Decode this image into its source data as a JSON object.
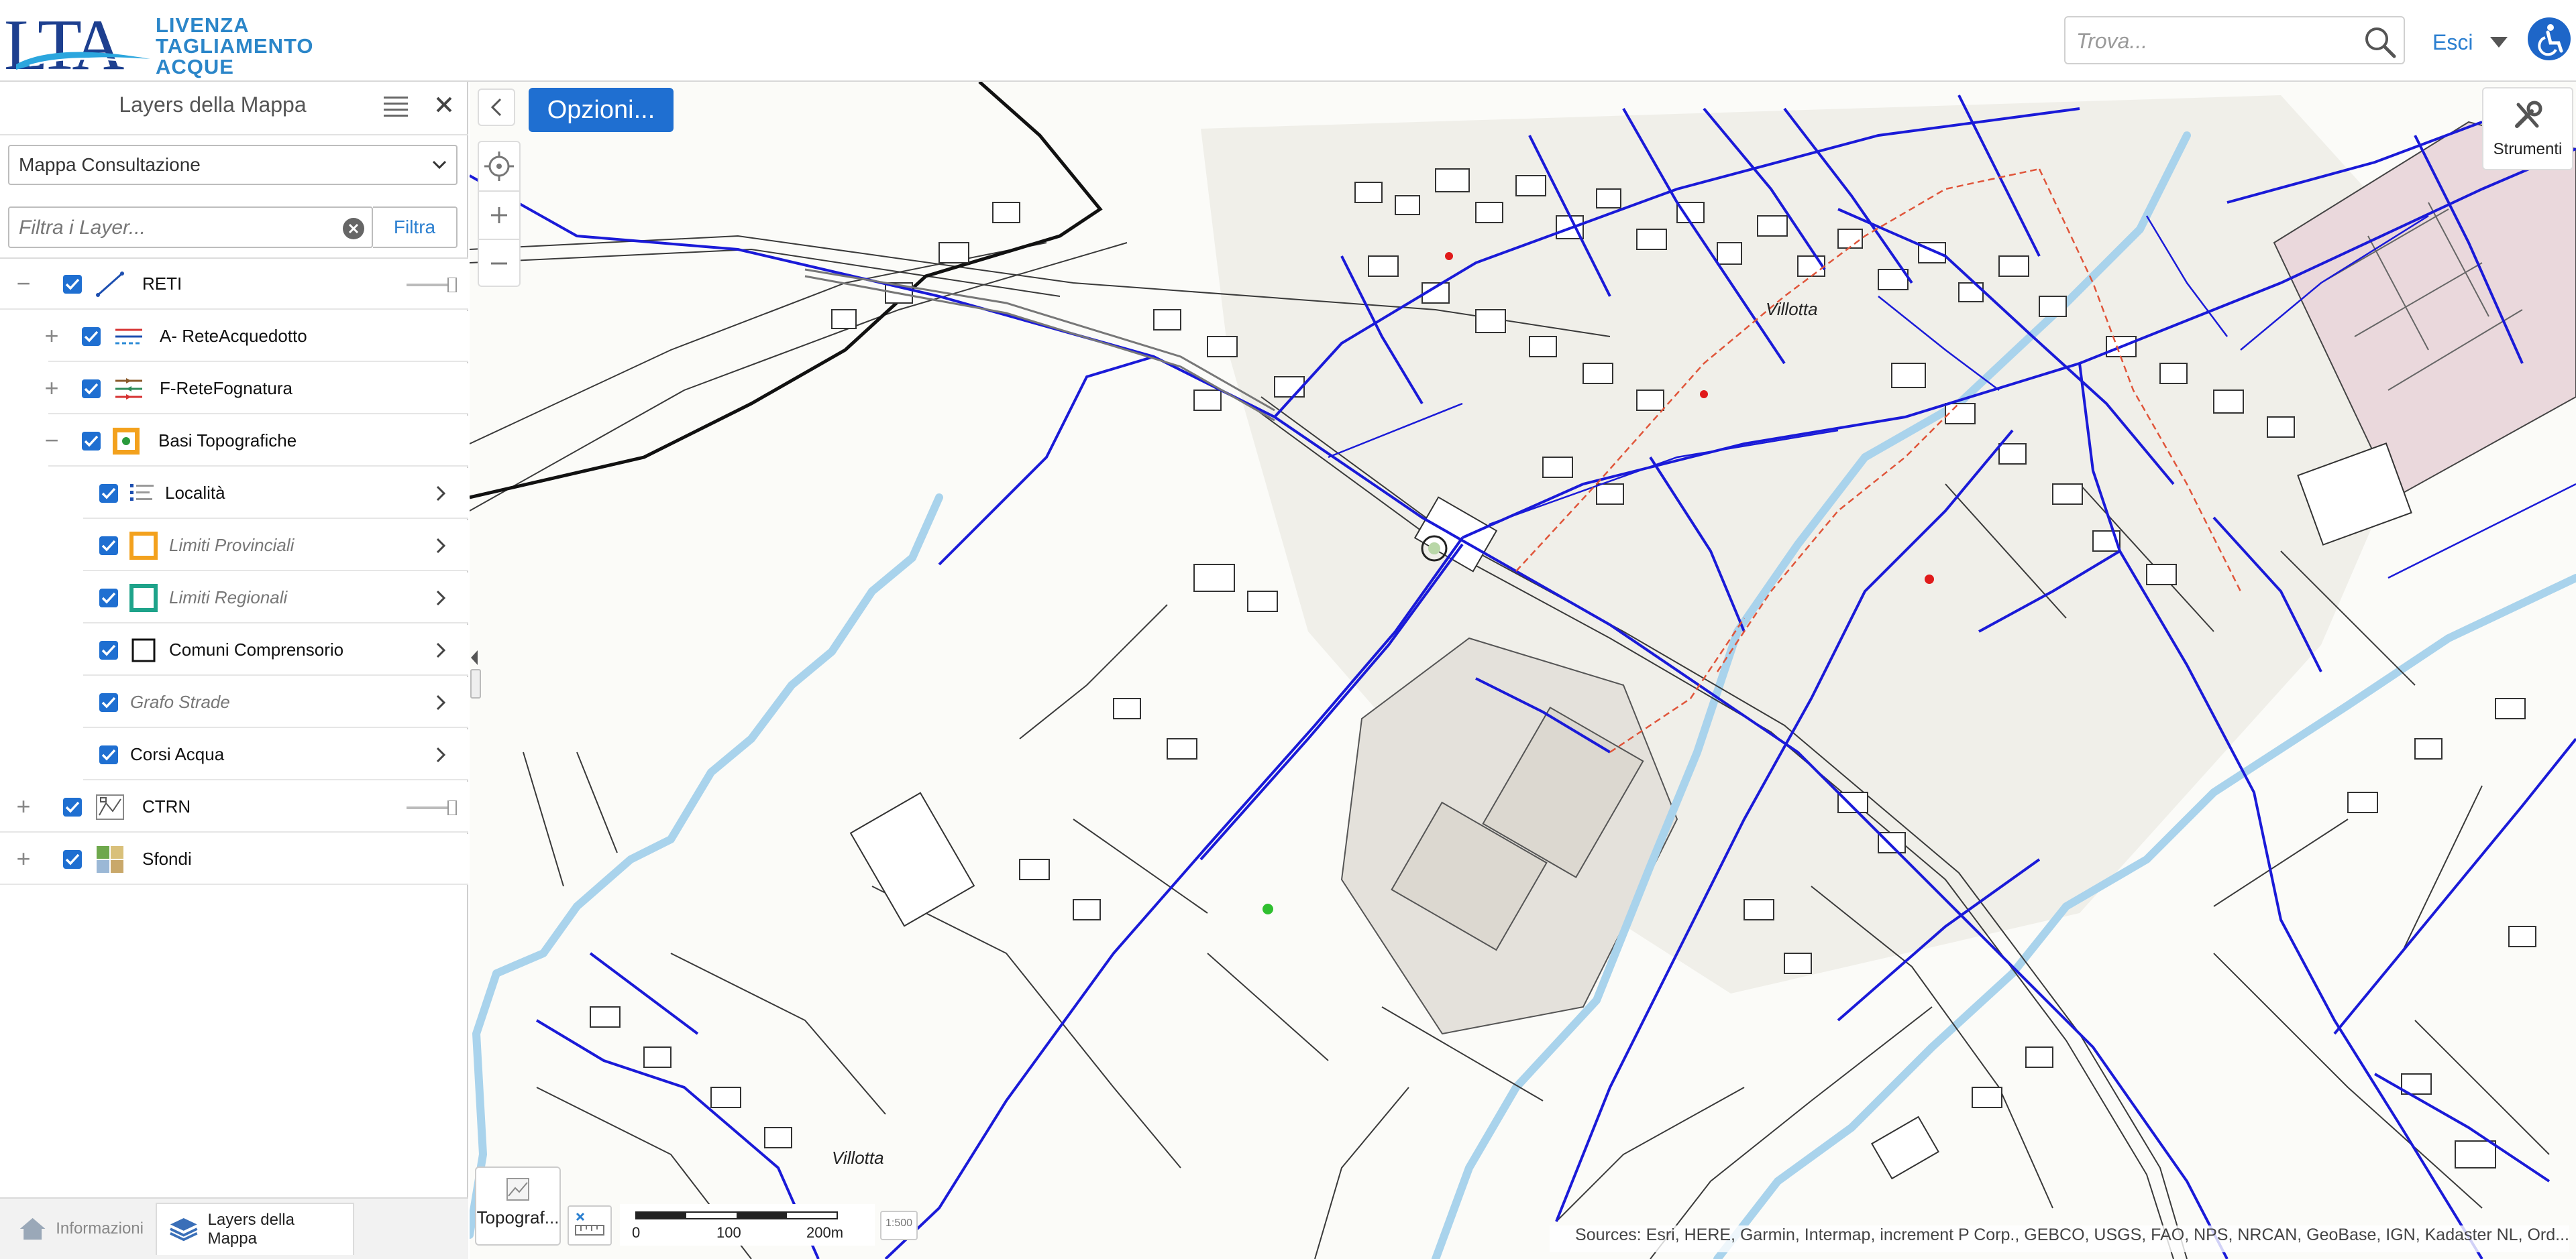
{
  "header": {
    "logo_mark": "LTA",
    "logo_text": "LIVENZA\nTAGLIAMENTO\nACQUE",
    "search_placeholder": "Trova...",
    "exit_label": "Esci"
  },
  "panel": {
    "title": "Layers della Mappa",
    "map_select_value": "Mappa Consultazione",
    "filter_placeholder": "Filtra i Layer...",
    "filter_button": "Filtra",
    "layers": [
      {
        "label": "RETI"
      },
      {
        "label": "A- ReteAcquedotto"
      },
      {
        "label": "F-ReteFognatura"
      },
      {
        "label": "Basi Topografiche"
      },
      {
        "label": "Località"
      },
      {
        "label": "Limiti Provinciali"
      },
      {
        "label": "Limiti Regionali"
      },
      {
        "label": "Comuni Comprensorio"
      },
      {
        "label": "Grafo Strade"
      },
      {
        "label": "Corsi Acqua"
      },
      {
        "label": "CTRN"
      },
      {
        "label": "Sfondi"
      }
    ],
    "tabs": {
      "info": "Informazioni",
      "layers": "Layers della Mappa"
    }
  },
  "map": {
    "options_button": "Opzioni...",
    "tools_button": "Strumenti",
    "basemap_button": "Topograf...",
    "scale": {
      "t0": "0",
      "t1": "100",
      "t2": "200m",
      "ratio": "1:500"
    },
    "attribution": "Sources: Esri, HERE, Garmin, Intermap, increment P Corp., GEBCO, USGS, FAO, NPS, NRCAN, GeoBase, IGN, Kadaster NL, Ord...",
    "labels": {
      "villotta": "Villotta",
      "villotta_small": "Villotta"
    }
  },
  "colors": {
    "accent": "#1f6fd1",
    "network_blue": "#1a1ad8",
    "river": "#a9d3ec",
    "industrial": "#e4e1db",
    "cemetery": "#ead8dc"
  }
}
